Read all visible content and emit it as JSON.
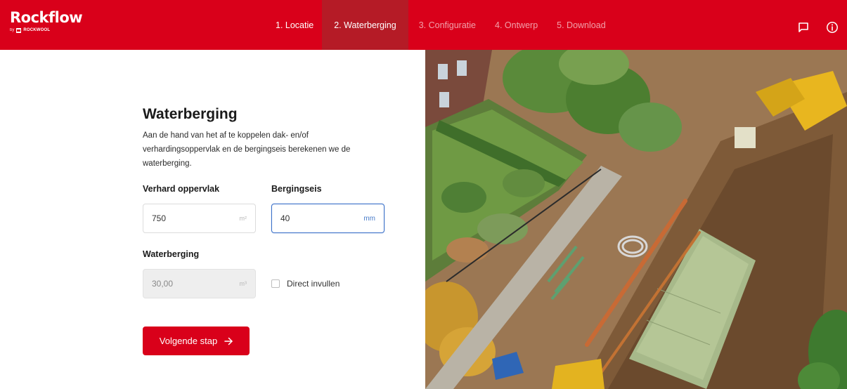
{
  "header": {
    "logo_text": "Rockflow",
    "logo_by": "by",
    "logo_brand": "ROCKWOOL",
    "steps": [
      {
        "label": "1. Locatie",
        "state": "completed"
      },
      {
        "label": "2. Waterberging",
        "state": "active"
      },
      {
        "label": "3. Configuratie",
        "state": "upcoming"
      },
      {
        "label": "4. Ontwerp",
        "state": "upcoming"
      },
      {
        "label": "5. Download",
        "state": "upcoming"
      }
    ],
    "icons": [
      "chat-icon",
      "info-icon"
    ]
  },
  "main": {
    "title": "Waterberging",
    "description": "Aan de hand van het af te koppelen dak- en/of verhardingsoppervlak en de bergingseis berekenen we de waterberging.",
    "verhard": {
      "label": "Verhard oppervlak",
      "value": "750",
      "unit": "m²"
    },
    "bergingseis": {
      "label": "Bergingseis",
      "value": "40",
      "unit": "mm"
    },
    "waterberging": {
      "label": "Waterberging",
      "value": "30,00",
      "unit": "m³"
    },
    "direct_invullen": {
      "label": "Direct invullen",
      "checked": false
    },
    "next_button": {
      "label": "Volgende stap",
      "icon": "arrow-right-icon"
    }
  },
  "colors": {
    "brand_red": "#d9001a",
    "active_step": "#b51b26",
    "focus_blue": "#3d72c9"
  }
}
